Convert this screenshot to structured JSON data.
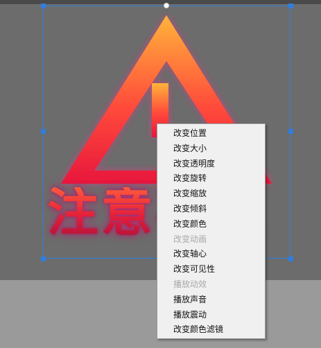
{
  "canvas": {
    "background_color": "#6c6c6c",
    "lower_area_color": "#9a9a9a",
    "selection_color": "#2f7de1"
  },
  "artwork": {
    "icon": "warning-triangle-icon",
    "text": "注意事项",
    "gradient_top": "#ffb33a",
    "gradient_bottom": "#e8173c",
    "glow_color": "#ff2a8c"
  },
  "context_menu": {
    "items": [
      {
        "label": "改变位置",
        "enabled": true
      },
      {
        "label": "改变大小",
        "enabled": true
      },
      {
        "label": "改变透明度",
        "enabled": true
      },
      {
        "label": "改变旋转",
        "enabled": true
      },
      {
        "label": "改变缩放",
        "enabled": true
      },
      {
        "label": "改变倾斜",
        "enabled": true
      },
      {
        "label": "改变颜色",
        "enabled": true
      },
      {
        "label": "改变动画",
        "enabled": false
      },
      {
        "label": "改变轴心",
        "enabled": true
      },
      {
        "label": "改变可见性",
        "enabled": true
      },
      {
        "label": "播放动效",
        "enabled": false
      },
      {
        "label": "播放声音",
        "enabled": true
      },
      {
        "label": "播放震动",
        "enabled": true
      },
      {
        "label": "改变颜色滤镜",
        "enabled": true
      }
    ]
  }
}
